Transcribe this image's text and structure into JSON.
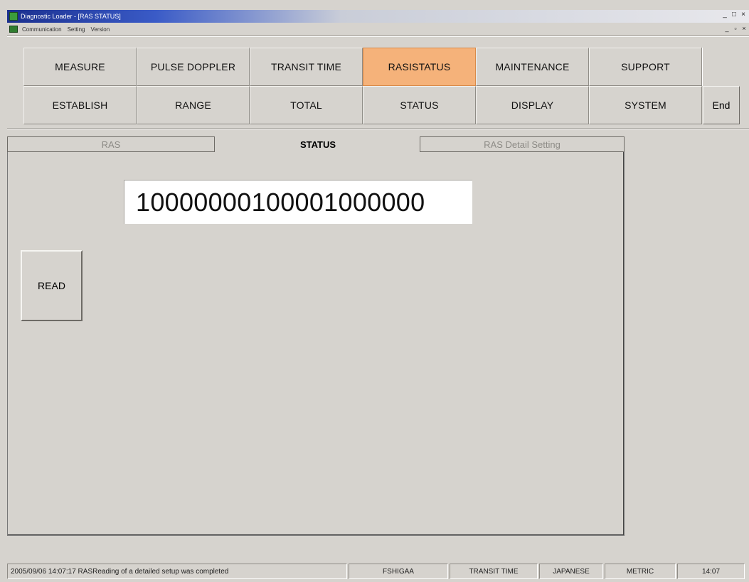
{
  "window": {
    "title": "Diagnostic Loader - [RAS STATUS]",
    "controls": [
      "_",
      "□",
      "×"
    ],
    "mdi_controls": [
      "_",
      "▫",
      "×"
    ]
  },
  "menubar": {
    "items": [
      "Communication",
      "Setting",
      "Version"
    ]
  },
  "nav": {
    "row1": [
      "MEASURE",
      "PULSE DOPPLER",
      "TRANSIT TIME",
      "RASISTATUS",
      "MAINTENANCE",
      "SUPPORT"
    ],
    "row2": [
      "ESTABLISH",
      "RANGE",
      "TOTAL",
      "STATUS",
      "DISPLAY",
      "SYSTEM"
    ],
    "active": "RASISTATUS",
    "end_label": "End"
  },
  "tabs": {
    "ras": "RAS",
    "status": "STATUS",
    "detail": "RAS Detail Setting",
    "active": "STATUS"
  },
  "main": {
    "status_value": "10000000100001000000",
    "read_label": "READ"
  },
  "statusbar": {
    "message": "2005/09/06 14:07:17 RASReading of a detailed setup was completed",
    "model": "FSHIGAA",
    "mode": "TRANSIT TIME",
    "language": "JAPANESE",
    "unit": "METRIC",
    "time": "14:07"
  },
  "colors": {
    "active_tab_fill": "#f5b27a",
    "face": "#d6d3ce",
    "title_bar": "#1b2f8e"
  }
}
